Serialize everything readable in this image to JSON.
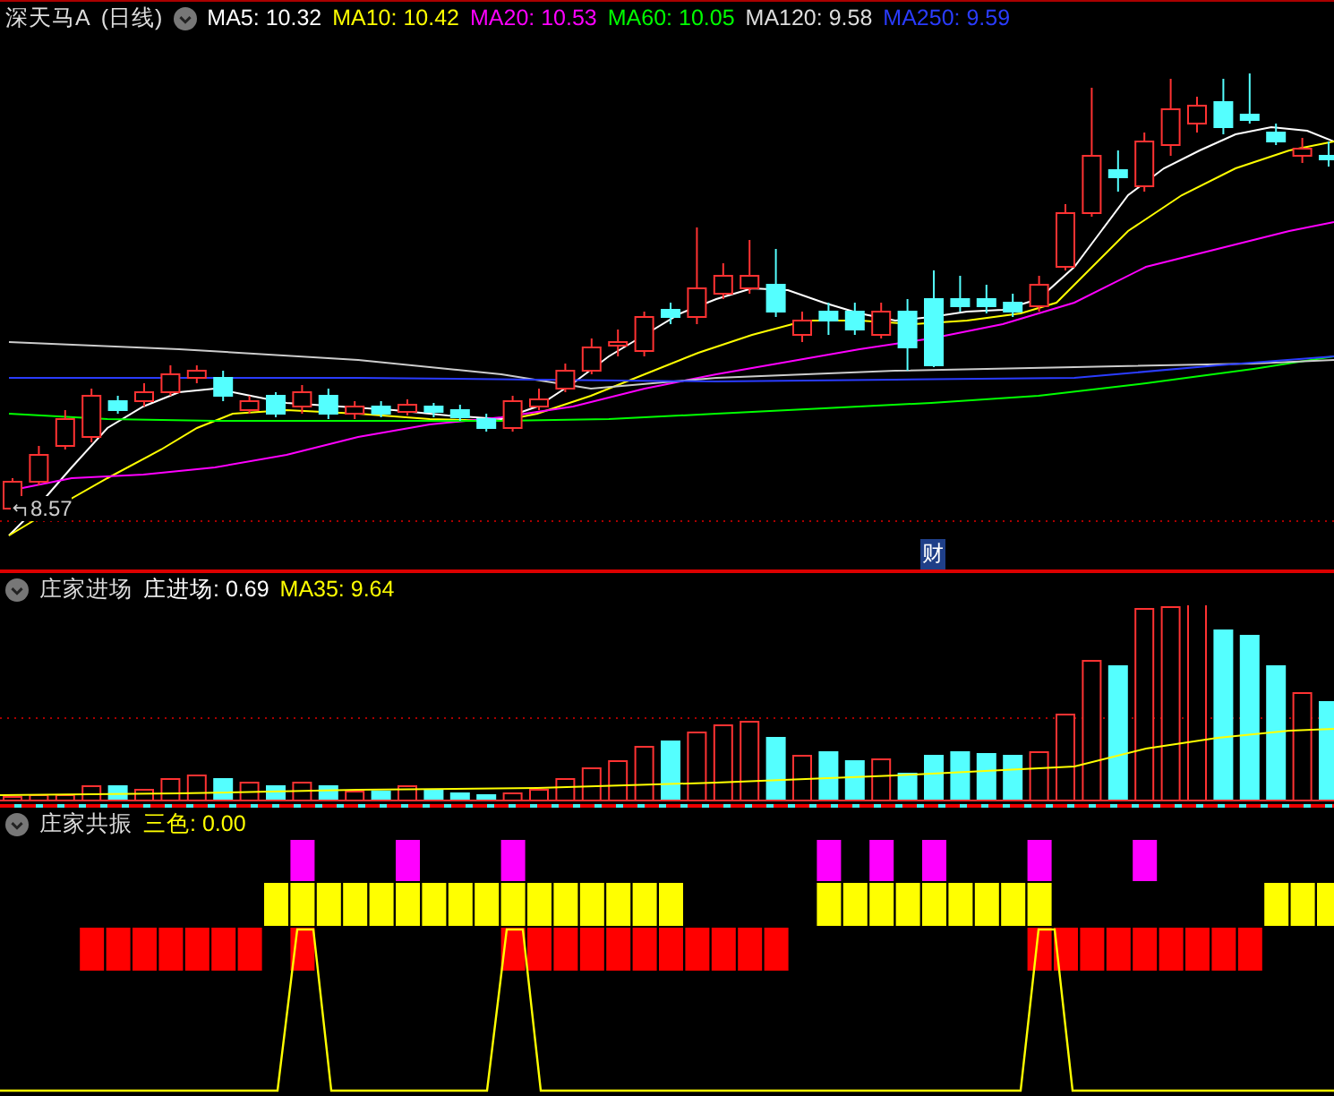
{
  "main_chart": {
    "stock_name": "深天马A",
    "period": "(日线)",
    "indicators": [
      {
        "label": "MA5: 10.32",
        "color": "#ffffff"
      },
      {
        "label": "MA10: 10.42",
        "color": "#ffff00"
      },
      {
        "label": "MA20: 10.53",
        "color": "#ff00ff"
      },
      {
        "label": "MA60: 10.05",
        "color": "#00ff00"
      },
      {
        "label": "MA120: 9.58",
        "color": "#dddddd"
      },
      {
        "label": "MA250: 9.59",
        "color": "#2a3cff"
      }
    ],
    "low_marker": "8.57",
    "badge": "财"
  },
  "indicator_panel": {
    "title": "庄家进场",
    "values": [
      {
        "label": "庄进场: 0.69",
        "color": "#ffffff"
      },
      {
        "label": "MA35: 9.64",
        "color": "#ffff00"
      }
    ]
  },
  "resonance_panel": {
    "title": "庄家共振",
    "values": [
      {
        "label": "三色: 0.00",
        "color": "#ffff00"
      }
    ]
  }
}
